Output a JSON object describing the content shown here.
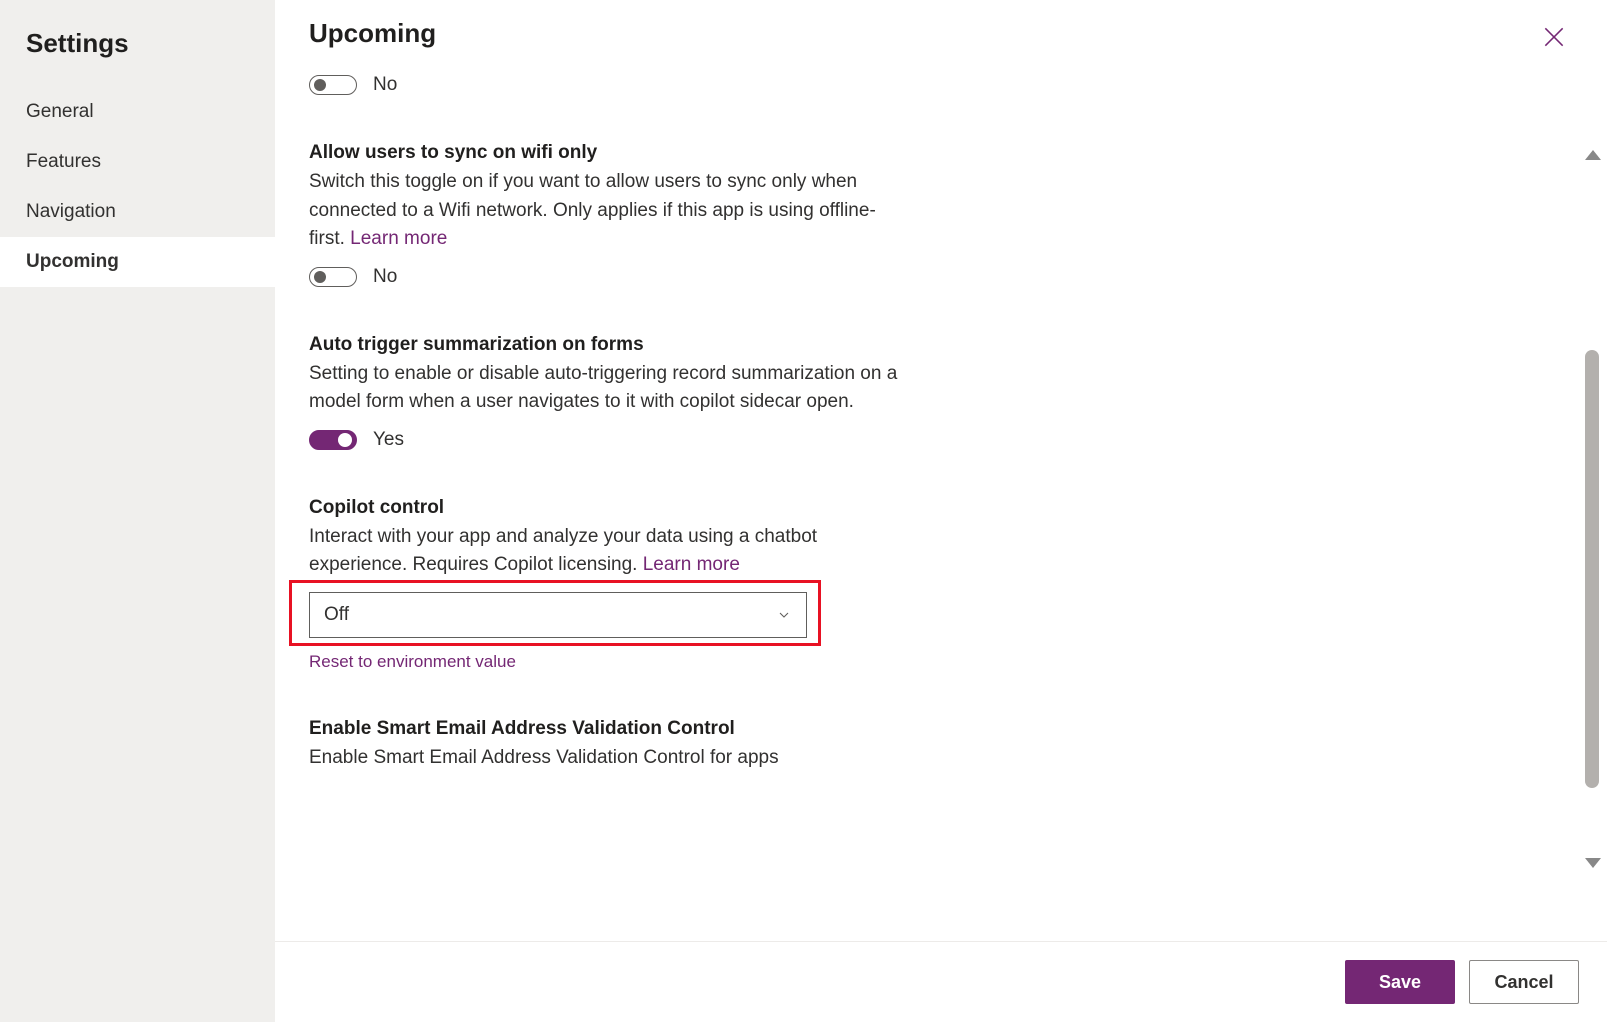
{
  "sidebar": {
    "title": "Settings",
    "items": [
      {
        "label": "General",
        "active": false
      },
      {
        "label": "Features",
        "active": false
      },
      {
        "label": "Navigation",
        "active": false
      },
      {
        "label": "Upcoming",
        "active": true
      }
    ]
  },
  "header": {
    "title": "Upcoming"
  },
  "settings": {
    "untitled_toggle": {
      "value_label": "No",
      "on": false
    },
    "wifi_sync": {
      "title": "Allow users to sync on wifi only",
      "desc": "Switch this toggle on if you want to allow users to sync only when connected to a Wifi network. Only applies if this app is using offline-first. ",
      "learn_more": "Learn more",
      "value_label": "No",
      "on": false
    },
    "auto_summarize": {
      "title": "Auto trigger summarization on forms",
      "desc": "Setting to enable or disable auto-triggering record summarization on a model form when a user navigates to it with copilot sidecar open.",
      "value_label": "Yes",
      "on": true
    },
    "copilot": {
      "title": "Copilot control",
      "desc": "Interact with your app and analyze your data using a chatbot experience. Requires Copilot licensing. ",
      "learn_more": "Learn more",
      "selected": "Off",
      "reset_label": "Reset to environment value"
    },
    "smart_email": {
      "title": "Enable Smart Email Address Validation Control",
      "desc": "Enable Smart Email Address Validation Control for apps"
    }
  },
  "footer": {
    "save": "Save",
    "cancel": "Cancel"
  }
}
